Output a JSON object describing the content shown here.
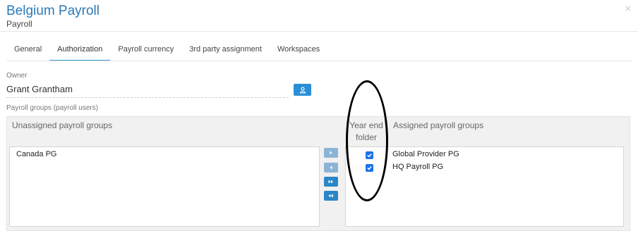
{
  "header": {
    "title": "Belgium Payroll",
    "subtitle": "Payroll",
    "close_icon": "close-icon"
  },
  "tabs": [
    {
      "label": "General",
      "active": false
    },
    {
      "label": "Authorization",
      "active": true
    },
    {
      "label": "Payroll currency",
      "active": false
    },
    {
      "label": "3rd party assignment",
      "active": false
    },
    {
      "label": "Workspaces",
      "active": false
    }
  ],
  "owner": {
    "label": "Owner",
    "value": "Grant Grantham",
    "button_icon": "user-icon"
  },
  "payroll_groups": {
    "label": "Payroll groups (payroll users)",
    "unassigned_header": "Unassigned payroll groups",
    "year_end_header": "Year end folder",
    "assigned_header": "Assigned payroll groups",
    "unassigned": [
      "Canada PG"
    ],
    "assigned": [
      {
        "name": "Global Provider PG",
        "year_end_folder": true
      },
      {
        "name": "HQ Payroll PG",
        "year_end_folder": true
      }
    ],
    "move_buttons": [
      {
        "icon": "chevron-right-icon",
        "enabled": false
      },
      {
        "icon": "chevron-left-icon",
        "enabled": false
      },
      {
        "icon": "double-chevron-right-icon",
        "enabled": true
      },
      {
        "icon": "double-chevron-left-icon",
        "enabled": true
      }
    ]
  },
  "colors": {
    "accent": "#2a7ab8",
    "button": "#2a8fd6",
    "tab_underline": "#2a9fd6",
    "checkbox": "#1a73e8"
  }
}
